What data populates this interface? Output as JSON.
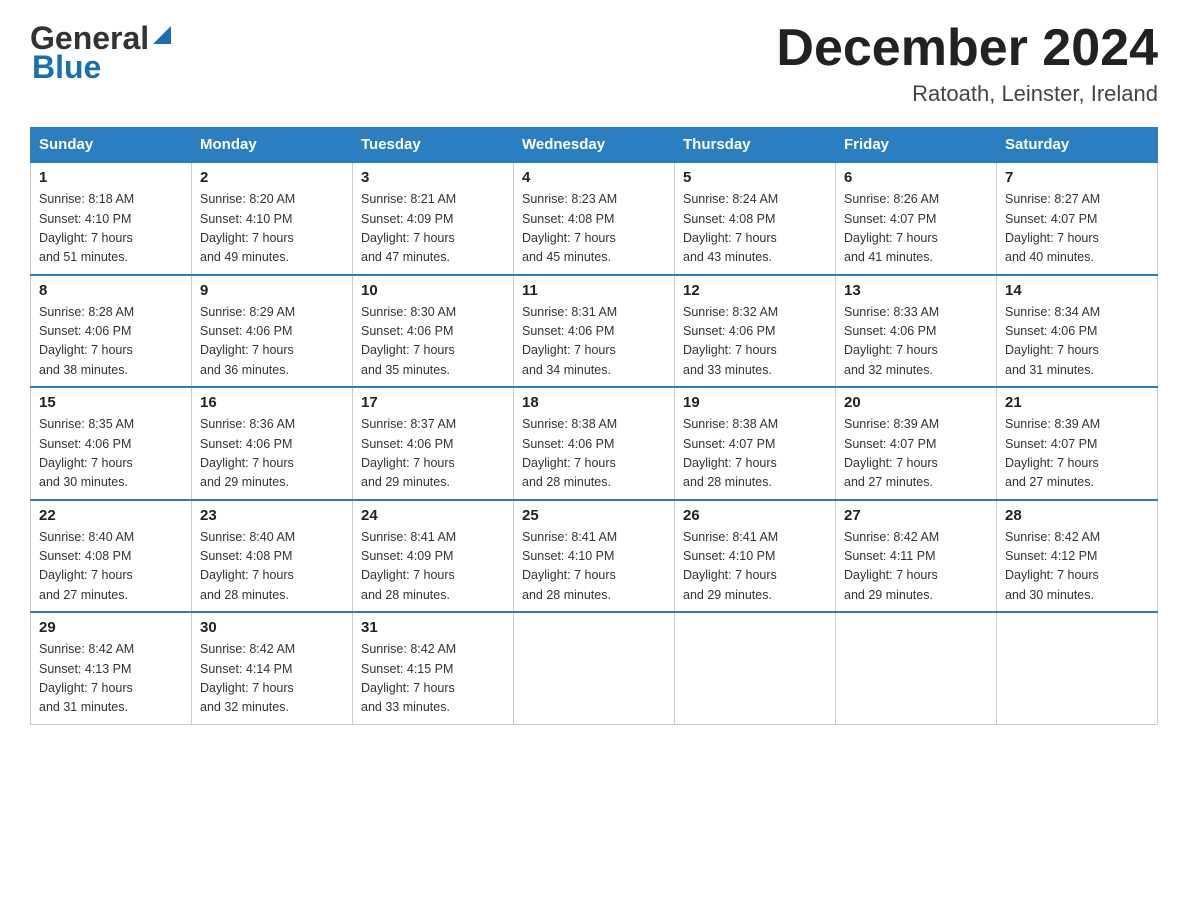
{
  "header": {
    "logo_general": "General",
    "logo_blue": "Blue",
    "month_title": "December 2024",
    "location": "Ratoath, Leinster, Ireland"
  },
  "days_of_week": [
    "Sunday",
    "Monday",
    "Tuesday",
    "Wednesday",
    "Thursday",
    "Friday",
    "Saturday"
  ],
  "weeks": [
    [
      {
        "day": "1",
        "sunrise": "Sunrise: 8:18 AM",
        "sunset": "Sunset: 4:10 PM",
        "daylight": "Daylight: 7 hours",
        "minutes": "and 51 minutes."
      },
      {
        "day": "2",
        "sunrise": "Sunrise: 8:20 AM",
        "sunset": "Sunset: 4:10 PM",
        "daylight": "Daylight: 7 hours",
        "minutes": "and 49 minutes."
      },
      {
        "day": "3",
        "sunrise": "Sunrise: 8:21 AM",
        "sunset": "Sunset: 4:09 PM",
        "daylight": "Daylight: 7 hours",
        "minutes": "and 47 minutes."
      },
      {
        "day": "4",
        "sunrise": "Sunrise: 8:23 AM",
        "sunset": "Sunset: 4:08 PM",
        "daylight": "Daylight: 7 hours",
        "minutes": "and 45 minutes."
      },
      {
        "day": "5",
        "sunrise": "Sunrise: 8:24 AM",
        "sunset": "Sunset: 4:08 PM",
        "daylight": "Daylight: 7 hours",
        "minutes": "and 43 minutes."
      },
      {
        "day": "6",
        "sunrise": "Sunrise: 8:26 AM",
        "sunset": "Sunset: 4:07 PM",
        "daylight": "Daylight: 7 hours",
        "minutes": "and 41 minutes."
      },
      {
        "day": "7",
        "sunrise": "Sunrise: 8:27 AM",
        "sunset": "Sunset: 4:07 PM",
        "daylight": "Daylight: 7 hours",
        "minutes": "and 40 minutes."
      }
    ],
    [
      {
        "day": "8",
        "sunrise": "Sunrise: 8:28 AM",
        "sunset": "Sunset: 4:06 PM",
        "daylight": "Daylight: 7 hours",
        "minutes": "and 38 minutes."
      },
      {
        "day": "9",
        "sunrise": "Sunrise: 8:29 AM",
        "sunset": "Sunset: 4:06 PM",
        "daylight": "Daylight: 7 hours",
        "minutes": "and 36 minutes."
      },
      {
        "day": "10",
        "sunrise": "Sunrise: 8:30 AM",
        "sunset": "Sunset: 4:06 PM",
        "daylight": "Daylight: 7 hours",
        "minutes": "and 35 minutes."
      },
      {
        "day": "11",
        "sunrise": "Sunrise: 8:31 AM",
        "sunset": "Sunset: 4:06 PM",
        "daylight": "Daylight: 7 hours",
        "minutes": "and 34 minutes."
      },
      {
        "day": "12",
        "sunrise": "Sunrise: 8:32 AM",
        "sunset": "Sunset: 4:06 PM",
        "daylight": "Daylight: 7 hours",
        "minutes": "and 33 minutes."
      },
      {
        "day": "13",
        "sunrise": "Sunrise: 8:33 AM",
        "sunset": "Sunset: 4:06 PM",
        "daylight": "Daylight: 7 hours",
        "minutes": "and 32 minutes."
      },
      {
        "day": "14",
        "sunrise": "Sunrise: 8:34 AM",
        "sunset": "Sunset: 4:06 PM",
        "daylight": "Daylight: 7 hours",
        "minutes": "and 31 minutes."
      }
    ],
    [
      {
        "day": "15",
        "sunrise": "Sunrise: 8:35 AM",
        "sunset": "Sunset: 4:06 PM",
        "daylight": "Daylight: 7 hours",
        "minutes": "and 30 minutes."
      },
      {
        "day": "16",
        "sunrise": "Sunrise: 8:36 AM",
        "sunset": "Sunset: 4:06 PM",
        "daylight": "Daylight: 7 hours",
        "minutes": "and 29 minutes."
      },
      {
        "day": "17",
        "sunrise": "Sunrise: 8:37 AM",
        "sunset": "Sunset: 4:06 PM",
        "daylight": "Daylight: 7 hours",
        "minutes": "and 29 minutes."
      },
      {
        "day": "18",
        "sunrise": "Sunrise: 8:38 AM",
        "sunset": "Sunset: 4:06 PM",
        "daylight": "Daylight: 7 hours",
        "minutes": "and 28 minutes."
      },
      {
        "day": "19",
        "sunrise": "Sunrise: 8:38 AM",
        "sunset": "Sunset: 4:07 PM",
        "daylight": "Daylight: 7 hours",
        "minutes": "and 28 minutes."
      },
      {
        "day": "20",
        "sunrise": "Sunrise: 8:39 AM",
        "sunset": "Sunset: 4:07 PM",
        "daylight": "Daylight: 7 hours",
        "minutes": "and 27 minutes."
      },
      {
        "day": "21",
        "sunrise": "Sunrise: 8:39 AM",
        "sunset": "Sunset: 4:07 PM",
        "daylight": "Daylight: 7 hours",
        "minutes": "and 27 minutes."
      }
    ],
    [
      {
        "day": "22",
        "sunrise": "Sunrise: 8:40 AM",
        "sunset": "Sunset: 4:08 PM",
        "daylight": "Daylight: 7 hours",
        "minutes": "and 27 minutes."
      },
      {
        "day": "23",
        "sunrise": "Sunrise: 8:40 AM",
        "sunset": "Sunset: 4:08 PM",
        "daylight": "Daylight: 7 hours",
        "minutes": "and 28 minutes."
      },
      {
        "day": "24",
        "sunrise": "Sunrise: 8:41 AM",
        "sunset": "Sunset: 4:09 PM",
        "daylight": "Daylight: 7 hours",
        "minutes": "and 28 minutes."
      },
      {
        "day": "25",
        "sunrise": "Sunrise: 8:41 AM",
        "sunset": "Sunset: 4:10 PM",
        "daylight": "Daylight: 7 hours",
        "minutes": "and 28 minutes."
      },
      {
        "day": "26",
        "sunrise": "Sunrise: 8:41 AM",
        "sunset": "Sunset: 4:10 PM",
        "daylight": "Daylight: 7 hours",
        "minutes": "and 29 minutes."
      },
      {
        "day": "27",
        "sunrise": "Sunrise: 8:42 AM",
        "sunset": "Sunset: 4:11 PM",
        "daylight": "Daylight: 7 hours",
        "minutes": "and 29 minutes."
      },
      {
        "day": "28",
        "sunrise": "Sunrise: 8:42 AM",
        "sunset": "Sunset: 4:12 PM",
        "daylight": "Daylight: 7 hours",
        "minutes": "and 30 minutes."
      }
    ],
    [
      {
        "day": "29",
        "sunrise": "Sunrise: 8:42 AM",
        "sunset": "Sunset: 4:13 PM",
        "daylight": "Daylight: 7 hours",
        "minutes": "and 31 minutes."
      },
      {
        "day": "30",
        "sunrise": "Sunrise: 8:42 AM",
        "sunset": "Sunset: 4:14 PM",
        "daylight": "Daylight: 7 hours",
        "minutes": "and 32 minutes."
      },
      {
        "day": "31",
        "sunrise": "Sunrise: 8:42 AM",
        "sunset": "Sunset: 4:15 PM",
        "daylight": "Daylight: 7 hours",
        "minutes": "and 33 minutes."
      },
      null,
      null,
      null,
      null
    ]
  ]
}
